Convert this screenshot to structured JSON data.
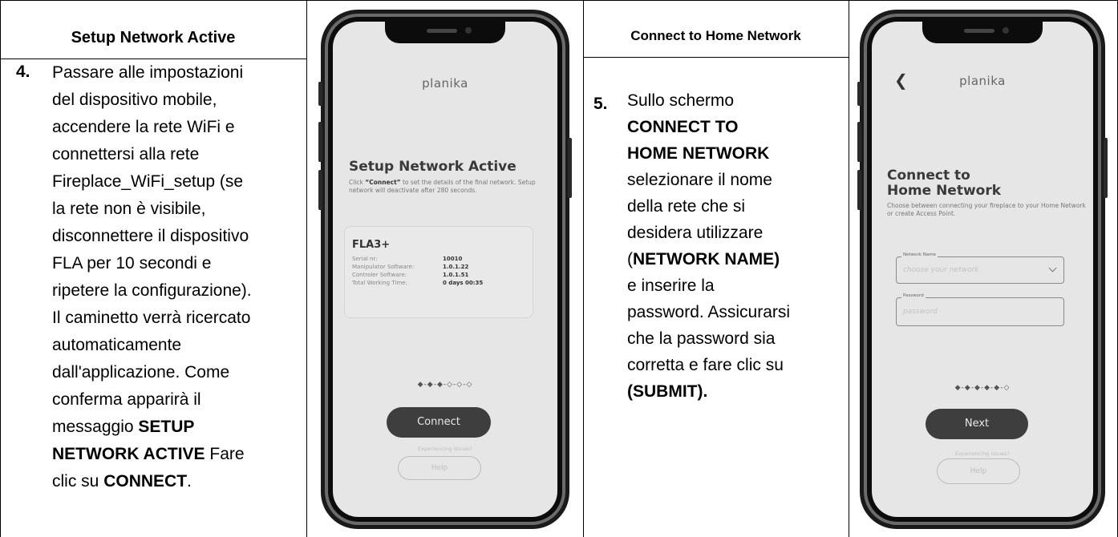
{
  "col1": {
    "header": "Setup Network Active",
    "step_number": "4.",
    "lines": [
      "Passare alle impostazioni",
      "del dispositivo mobile,",
      "accendere la rete WiFi e",
      "connettersi alla rete",
      "Fireplace_WiFi_setup (se",
      "la rete non è visibile,",
      "disconnettere il dispositivo",
      "FLA per 10 secondi e",
      "ripetere la configurazione).",
      "Il caminetto verrà ricercato",
      "automaticamente",
      "dall'applicazione. Come",
      "conferma apparirà il",
      "messaggio ",
      "SETUP",
      "NETWORK ACTIVE",
      " Fare",
      "clic su  ",
      "CONNECT",
      "."
    ]
  },
  "phone1": {
    "brand": "planika",
    "title": "Setup Network Active",
    "subtitle_pre": "Click ",
    "subtitle_bold": "“Connect”",
    "subtitle_post": " to set the details of the final network. Setup network will deactivate after 280 seconds.",
    "device": {
      "name": "FLA3+",
      "rows": [
        {
          "label": "Serial nr:",
          "value": "10010"
        },
        {
          "label": "Manipulator Software:",
          "value": "1.0.1.22"
        },
        {
          "label": "Controler Software:",
          "value": "1.0.1.51"
        },
        {
          "label": "Total Working Time:",
          "value": "0 days  00:35"
        }
      ]
    },
    "progress": "◆-◆-◆-◇-◇-◇",
    "primary_button": "Connect",
    "issues_text": "Experiencing issues?",
    "help_button": "Help"
  },
  "col3": {
    "header": "Connect to Home Network",
    "step_number": "5.",
    "line1": "Sullo schermo",
    "bold1": "CONNECT TO",
    "bold2": "HOME NETWORK",
    "line2": "selezionare il nome",
    "line3": "della rete che si",
    "line4": "desidera utilizzare",
    "paren_open": "(",
    "bold3": "NETWORK NAME)",
    "line5": "e inserire la",
    "line6": "password. Assicurarsi",
    "line7": "che la password sia",
    "line8": "corretta e fare clic su",
    "bold4": "(SUBMIT)."
  },
  "phone2": {
    "brand": "planika",
    "title_line1": "Connect to",
    "title_line2": "Home Network",
    "subtitle": "Choose between connecting your fireplace to your Home Network or create Access Point.",
    "network_label": "Network Name",
    "network_placeholder": "choose your network",
    "password_label": "Password",
    "password_placeholder": "password",
    "progress": "◆-◆-◆-◆-◆-◇",
    "primary_button": "Next",
    "issues_text": "Experiencing issues?",
    "help_button": "Help"
  }
}
